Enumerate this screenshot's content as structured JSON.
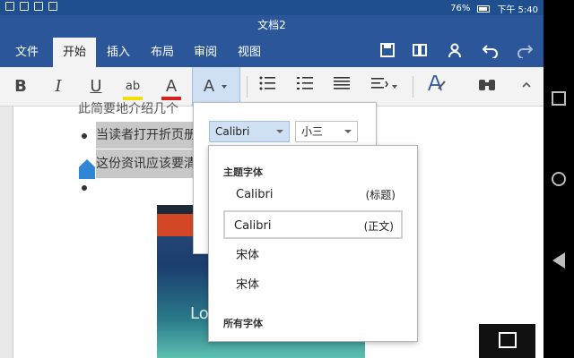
{
  "status": {
    "battery": "76%",
    "time": "下午 5:40"
  },
  "window_title": "文档2",
  "tabs": [
    "文件",
    "开始",
    "插入",
    "布局",
    "审阅",
    "视图"
  ],
  "ribbon": {
    "bold": "B",
    "italic": "I",
    "underline": "U",
    "highlight": "ab",
    "font_color": "A",
    "font_menu": "A"
  },
  "doc": {
    "line1": "此简要地介绍几个",
    "line2": "当读者打开折页册",
    "line3": "这份资讯应该要清",
    "image_text": "Lo"
  },
  "font_panel": {
    "font_name": "Calibri",
    "font_size": "小三"
  },
  "font_dropdown": {
    "theme_heading": "主题字体",
    "all_heading": "所有字体",
    "items": [
      {
        "name": "Calibri",
        "tag": "(标题)"
      },
      {
        "name": "Calibri",
        "tag": "(正文)"
      },
      {
        "name": "宋体",
        "tag": ""
      },
      {
        "name": "宋体",
        "tag": ""
      }
    ]
  }
}
